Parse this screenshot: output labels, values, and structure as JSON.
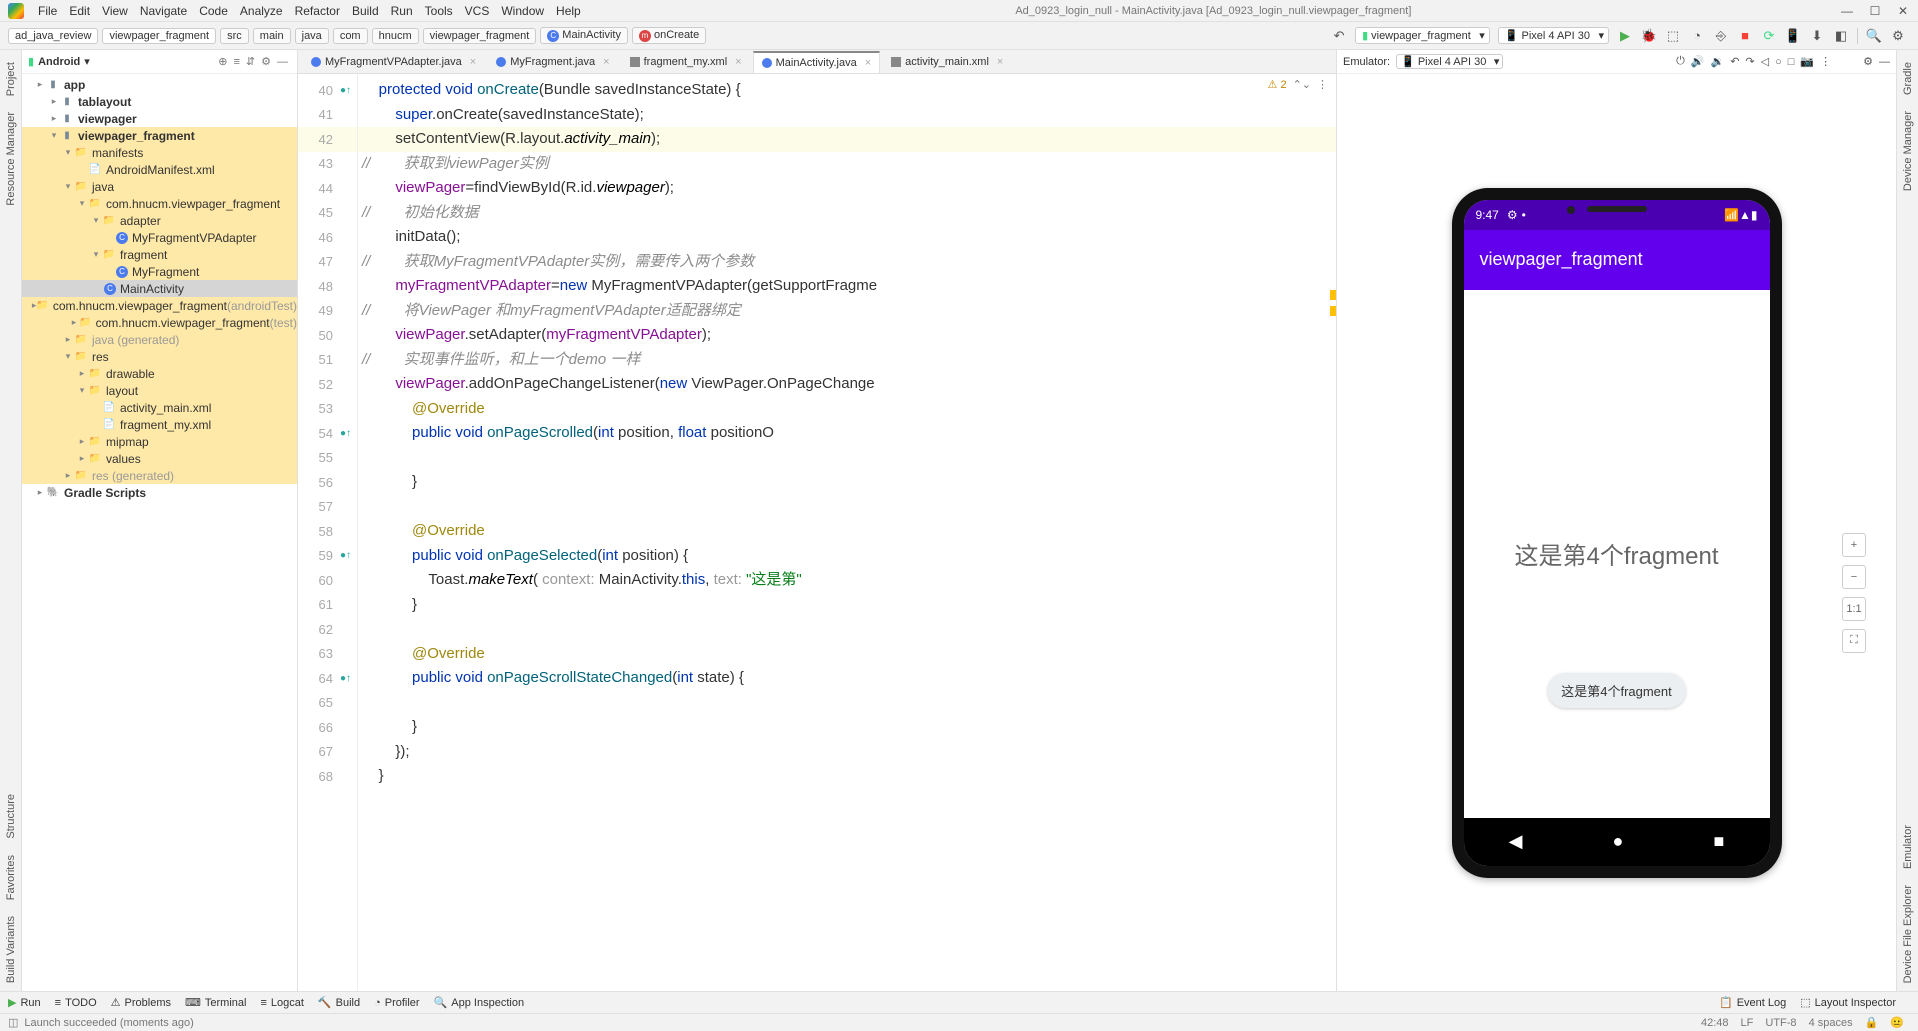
{
  "window": {
    "title": "Ad_0923_login_null - MainActivity.java [Ad_0923_login_null.viewpager_fragment]"
  },
  "menu": [
    "File",
    "Edit",
    "View",
    "Navigate",
    "Code",
    "Analyze",
    "Refactor",
    "Build",
    "Run",
    "Tools",
    "VCS",
    "Window",
    "Help"
  ],
  "breadcrumb": {
    "project": "ad_java_review",
    "module": "viewpager_fragment",
    "path": [
      "src",
      "main",
      "java",
      "com",
      "hnucm",
      "viewpager_fragment"
    ],
    "class_icon": "C",
    "class": "MainActivity",
    "method_icon": "m",
    "method": "onCreate"
  },
  "run_config": {
    "module": "viewpager_fragment",
    "device": "Pixel 4 API 30"
  },
  "project_panel": {
    "view": "Android",
    "tree": {
      "app": "app",
      "tablayout": "tablayout",
      "viewpager": "viewpager",
      "viewpager_fragment": "viewpager_fragment",
      "manifests": "manifests",
      "manifest_file": "AndroidManifest.xml",
      "java": "java",
      "pkg": "com.hnucm.viewpager_fragment",
      "adapter": "adapter",
      "adapter_cls": "MyFragmentVPAdapter",
      "fragment": "fragment",
      "fragment_cls": "MyFragment",
      "main_activity": "MainActivity",
      "pkg_at": "com.hnucm.viewpager_fragment",
      "pkg_at_suffix": " (androidTest)",
      "pkg_test": "com.hnucm.viewpager_fragment",
      "pkg_test_suffix": " (test)",
      "java_gen": "java",
      "java_gen_suffix": " (generated)",
      "res": "res",
      "drawable": "drawable",
      "layout": "layout",
      "ly1": "activity_main.xml",
      "ly2": "fragment_my.xml",
      "mipmap": "mipmap",
      "values": "values",
      "res_gen": "res",
      "res_gen_suffix": " (generated)",
      "gradle": "Gradle Scripts"
    }
  },
  "tabs": [
    {
      "label": "MyFragmentVPAdapter.java",
      "icon": "C"
    },
    {
      "label": "MyFragment.java",
      "icon": "C"
    },
    {
      "label": "fragment_my.xml",
      "icon": "xml"
    },
    {
      "label": "MainActivity.java",
      "icon": "C",
      "active": true
    },
    {
      "label": "activity_main.xml",
      "icon": "xml"
    }
  ],
  "editor": {
    "warnings": "2",
    "lines": [
      {
        "n": 40,
        "icon": true
      },
      {
        "n": 41
      },
      {
        "n": 42,
        "cur": true
      },
      {
        "n": 43
      },
      {
        "n": 44
      },
      {
        "n": 45
      },
      {
        "n": 46
      },
      {
        "n": 47
      },
      {
        "n": 48
      },
      {
        "n": 49
      },
      {
        "n": 50
      },
      {
        "n": 51
      },
      {
        "n": 52
      },
      {
        "n": 53
      },
      {
        "n": 54,
        "icon": true
      },
      {
        "n": 55
      },
      {
        "n": 56
      },
      {
        "n": 57
      },
      {
        "n": 58
      },
      {
        "n": 59,
        "icon": true
      },
      {
        "n": 60
      },
      {
        "n": 61
      },
      {
        "n": 62
      },
      {
        "n": 63
      },
      {
        "n": 64,
        "icon": true
      },
      {
        "n": 65
      },
      {
        "n": 66
      },
      {
        "n": 67
      },
      {
        "n": 68
      }
    ],
    "code": {
      "l40": {
        "kw1": "protected",
        "kw2": "void",
        "m": "onCreate",
        "p": "(Bundle savedInstanceState) {"
      },
      "l41": {
        "kw": "super",
        "rest": ".onCreate(savedInstanceState);"
      },
      "l42": {
        "pre": "setContentView(R.layout.",
        "it": "activity_main",
        "post": ");"
      },
      "l43": {
        "slash": "//",
        "cmt": "        获取到viewPager实例"
      },
      "l44": {
        "f": "viewPager",
        "eq": "=findViewById(R.id.",
        "it": "viewpager",
        "post": ");"
      },
      "l45": {
        "slash": "//",
        "cmt": "        初始化数据"
      },
      "l46": {
        "txt": "initData();"
      },
      "l47": {
        "slash": "//",
        "cmt": "        获取MyFragmentVPAdapter实例，需要传入两个参数"
      },
      "l48": {
        "f": "myFragmentVPAdapter",
        "eq": "=",
        "kw": "new",
        "rest": " MyFragmentVPAdapter(getSupportFragme"
      },
      "l49": {
        "slash": "//",
        "cmt": "        将ViewPager 和myFragmentVPAdapter适配器绑定"
      },
      "l50": {
        "f": "viewPager",
        "dot": ".setAdapter(",
        "f2": "myFragmentVPAdapter",
        "post": ");"
      },
      "l51": {
        "slash": "//",
        "cmt": "        实现事件监听，和上一个demo 一样"
      },
      "l52": {
        "f": "viewPager",
        "dot": ".addOnPageChangeListener(",
        "kw": "new",
        "rest": " ViewPager.OnPageChange"
      },
      "l53": {
        "ann": "@Override"
      },
      "l54": {
        "kw1": "public",
        "kw2": "void",
        "m": "onPageScrolled",
        "p": "(",
        "kw3": "int",
        "p2": " position, ",
        "kw4": "float",
        "p3": " positionO"
      },
      "l56": {
        "brace": "}"
      },
      "l58": {
        "ann": "@Override"
      },
      "l59": {
        "kw1": "public",
        "kw2": "void",
        "m": "onPageSelected",
        "p": "(",
        "kw3": "int",
        "p2": " position) {"
      },
      "l60": {
        "pre": "Toast.",
        "it": "makeText",
        "open": "( ",
        "h1": "context:",
        "a1": " MainActivity.",
        "kw": "this",
        "c": ", ",
        "h2": "text:",
        "s": " \"这是第\""
      },
      "l61": {
        "brace": "}"
      },
      "l63": {
        "ann": "@Override"
      },
      "l64": {
        "kw1": "public",
        "kw2": "void",
        "m": "onPageScrollStateChanged",
        "p": "(",
        "kw3": "int",
        "p2": " state) {"
      },
      "l66": {
        "brace": "}"
      },
      "l67": {
        "brace": "});"
      },
      "l68": {
        "brace": "}"
      }
    }
  },
  "emulator": {
    "label": "Emulator:",
    "device": "Pixel 4 API 30",
    "status_time": "9:47",
    "app_title": "viewpager_fragment",
    "fragment_text": "这是第4个fragment",
    "toast": "这是第4个fragment"
  },
  "bottom_tools": {
    "run": "Run",
    "todo": "TODO",
    "problems": "Problems",
    "terminal": "Terminal",
    "logcat": "Logcat",
    "build": "Build",
    "profiler": "Profiler",
    "inspection": "App Inspection",
    "eventlog": "Event Log",
    "layoutinsp": "Layout Inspector"
  },
  "status": {
    "msg": "Launch succeeded (moments ago)",
    "pos": "42:48",
    "lf": "LF",
    "enc": "UTF-8",
    "indent": "4 spaces"
  },
  "left_strip": {
    "project": "Project",
    "resources": "Resource Manager",
    "structure": "Structure",
    "favorites": "Favorites",
    "variants": "Build Variants"
  },
  "right_strip": {
    "gradle": "Gradle",
    "device_mgr": "Device Manager",
    "emulator": "Emulator",
    "dev_explorer": "Device File Explorer"
  }
}
